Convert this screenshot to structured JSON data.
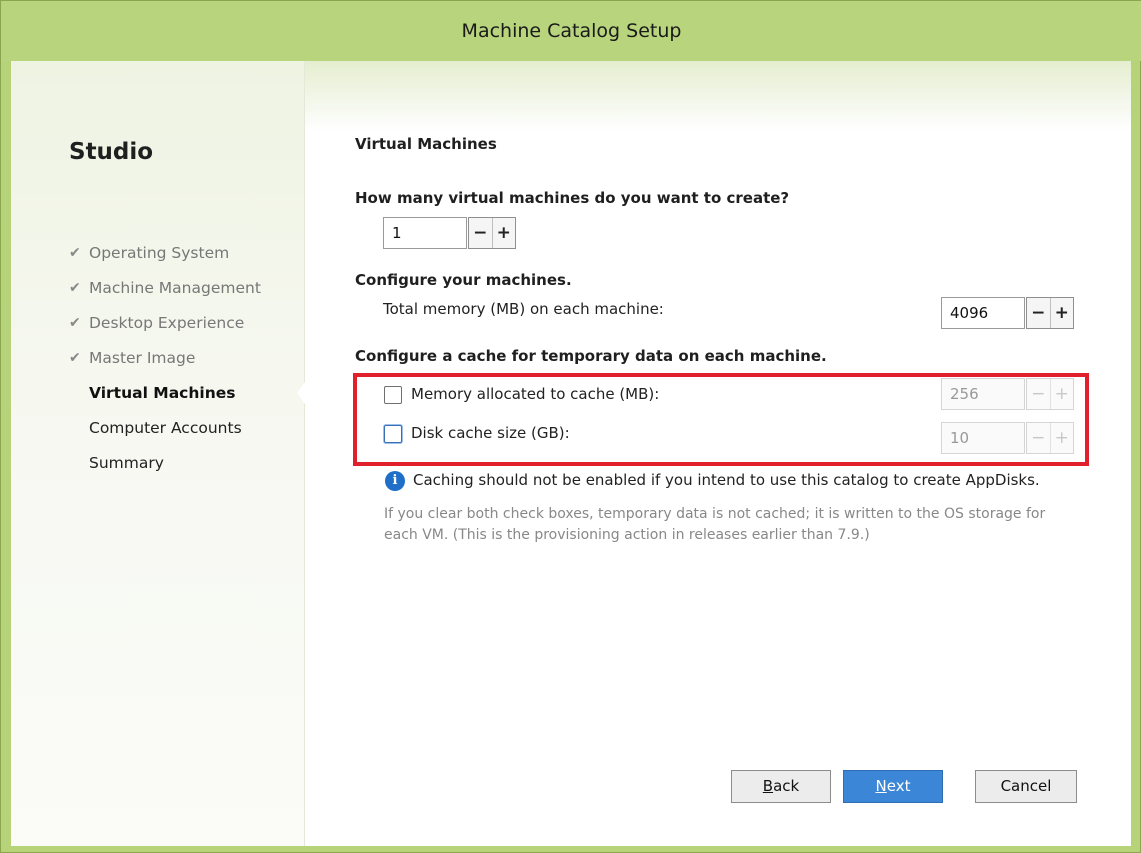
{
  "window": {
    "title": "Machine Catalog Setup"
  },
  "sidebar": {
    "brand": "Studio",
    "steps": [
      {
        "label": "Operating System",
        "status": "done"
      },
      {
        "label": "Machine Management",
        "status": "done"
      },
      {
        "label": "Desktop Experience",
        "status": "done"
      },
      {
        "label": "Master Image",
        "status": "done"
      },
      {
        "label": "Virtual Machines",
        "status": "current"
      },
      {
        "label": "Computer Accounts",
        "status": "pending"
      },
      {
        "label": "Summary",
        "status": "pending"
      }
    ],
    "check_glyph": "✔"
  },
  "main": {
    "heading": "Virtual Machines",
    "vm_count": {
      "question": "How many virtual machines do you want to create?",
      "value": "1"
    },
    "configure": {
      "heading": "Configure your machines.",
      "memory_label": "Total memory (MB) on each machine:",
      "memory_value": "4096"
    },
    "cache": {
      "heading": "Configure a cache for temporary data on each machine.",
      "memory_cache": {
        "label": "Memory allocated to cache (MB):",
        "value": "256",
        "checked": false
      },
      "disk_cache": {
        "label": "Disk cache size (GB):",
        "value": "10",
        "checked": false
      }
    },
    "info": {
      "icon_glyph": "i",
      "text": "Caching should not be enabled if you intend to use this catalog to create AppDisks."
    },
    "note": "If you clear both check boxes, temporary data is not cached; it is written to the OS storage for each VM. (This is the provisioning action in releases earlier than 7.9.)"
  },
  "stepper": {
    "minus": "−",
    "plus": "+"
  },
  "buttons": {
    "back": {
      "accel": "B",
      "rest": "ack"
    },
    "next": {
      "accel": "N",
      "rest": "ext"
    },
    "cancel": "Cancel"
  },
  "colors": {
    "title_bar": "#b8d47c",
    "highlight_border": "#e0202a",
    "primary_button": "#3b86d6",
    "info_icon": "#1f6fc9"
  }
}
